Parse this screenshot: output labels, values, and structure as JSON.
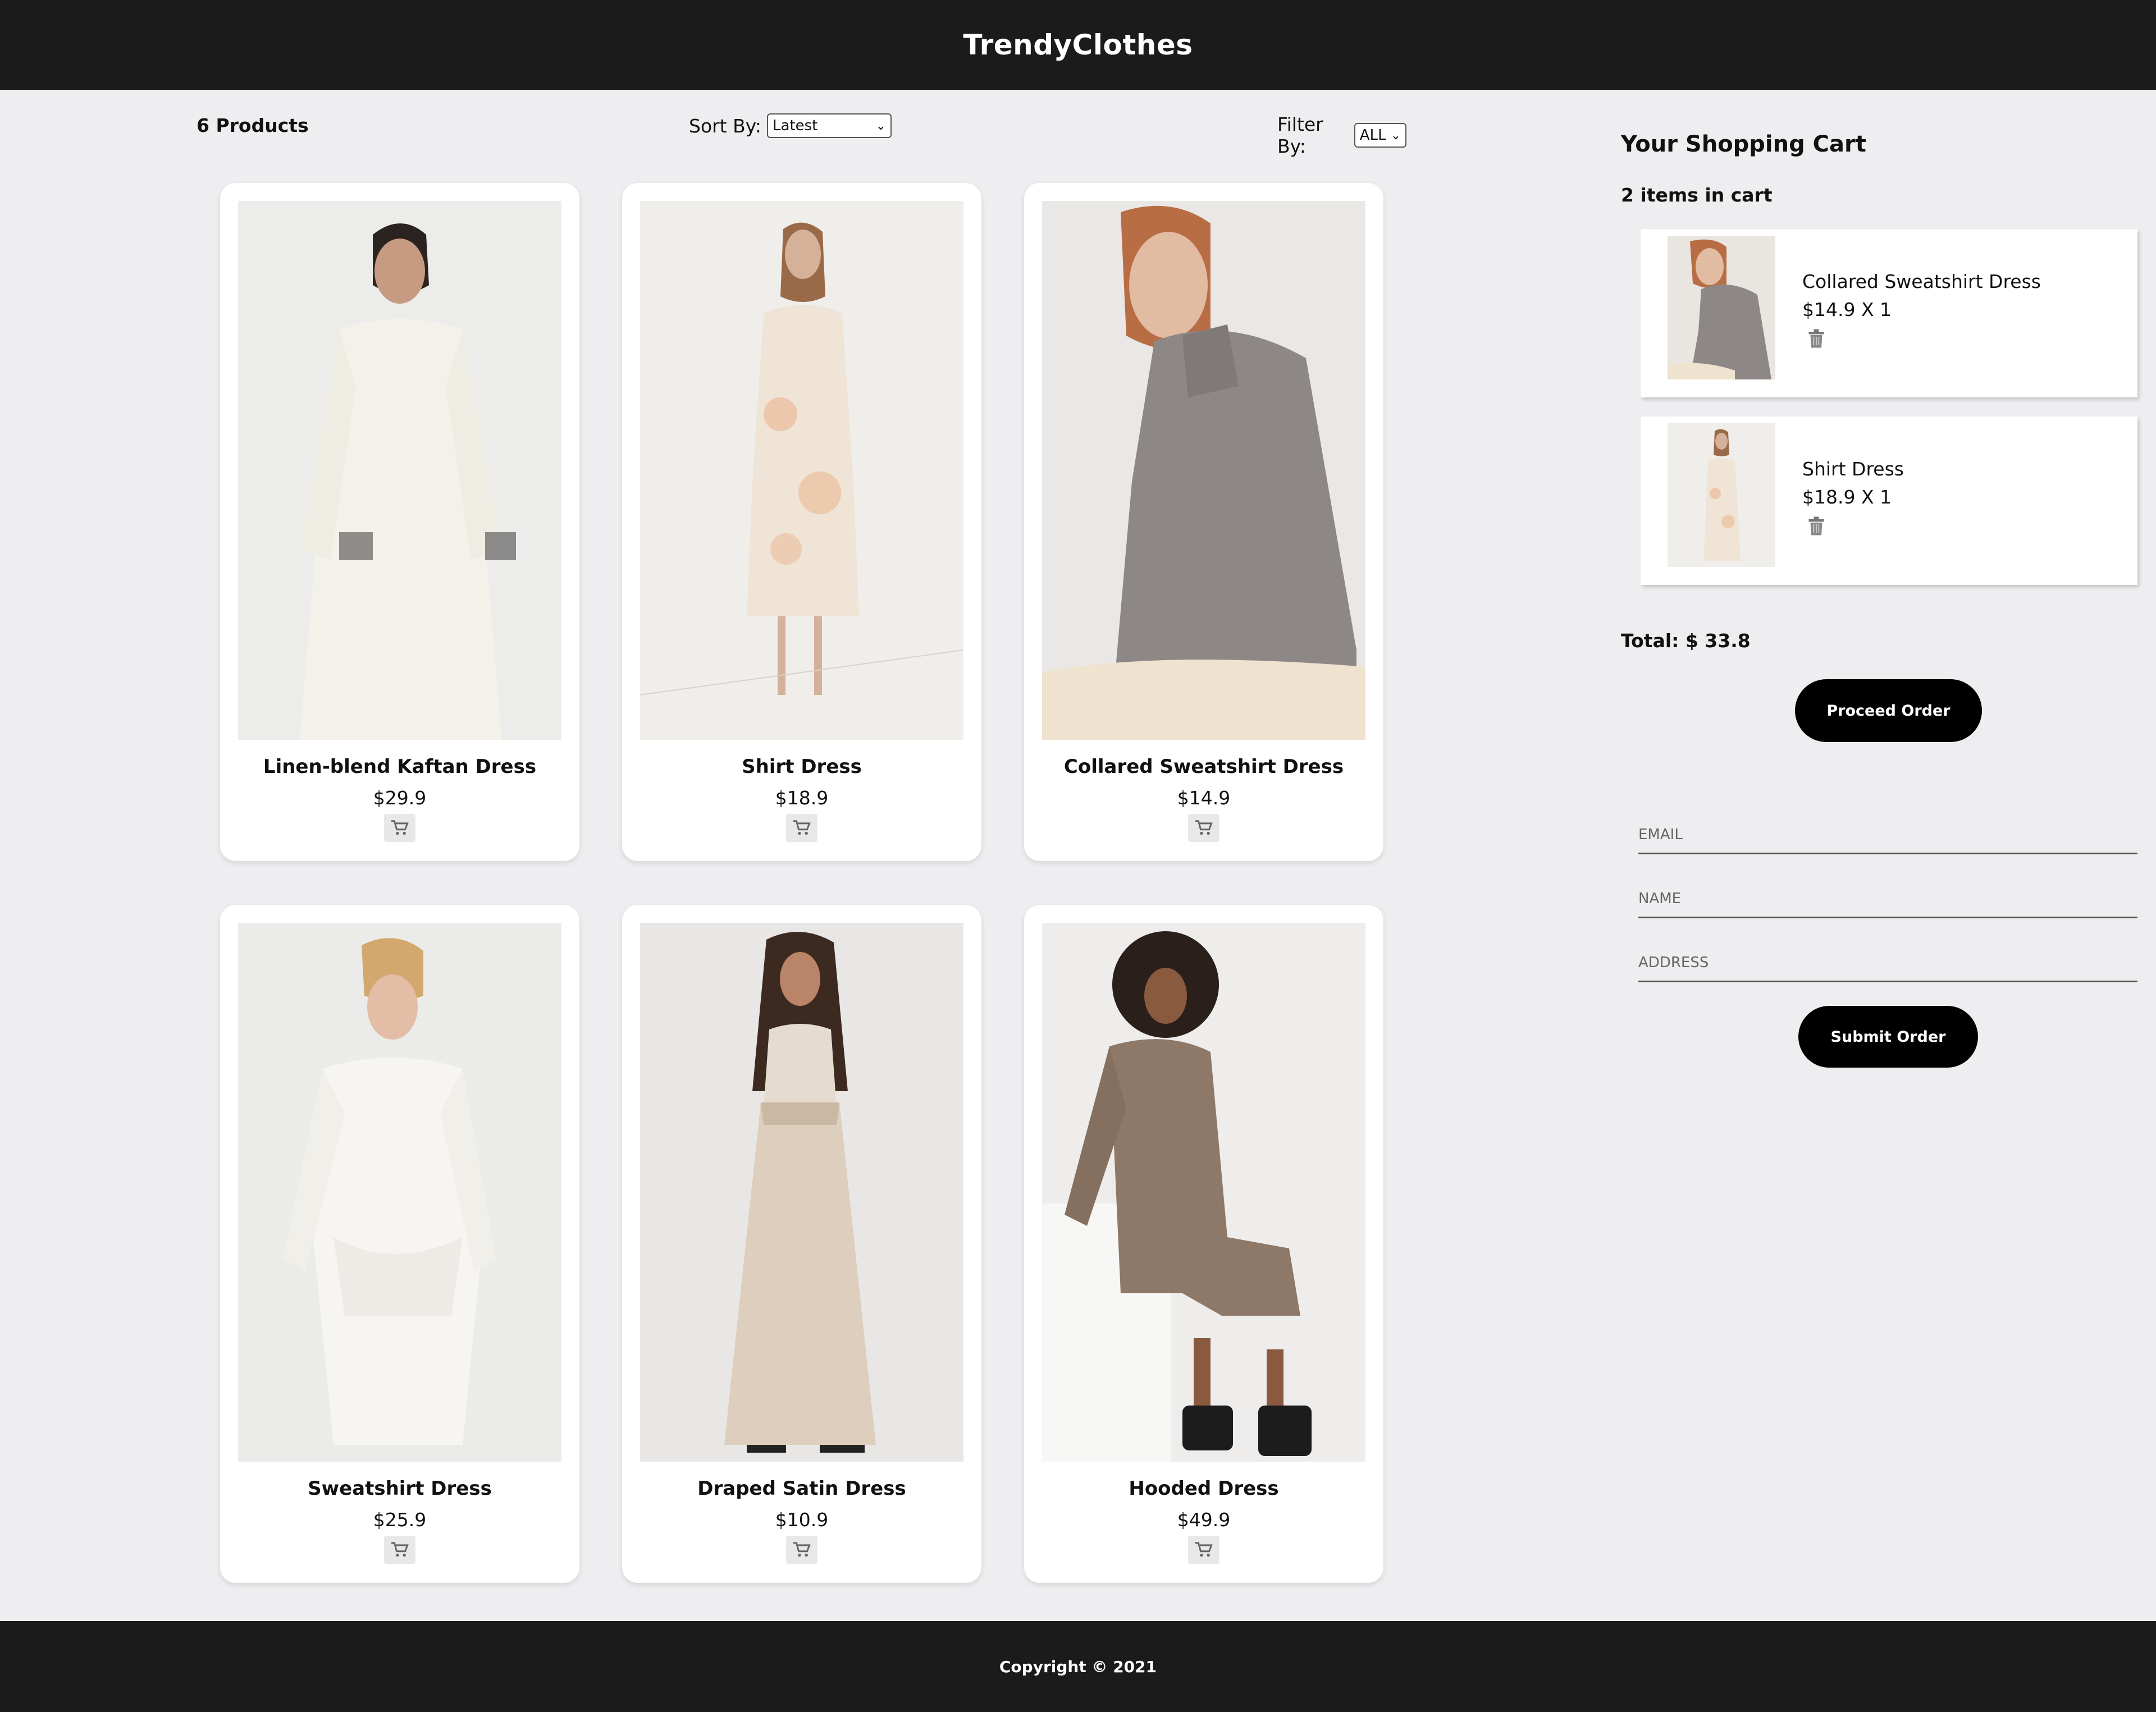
{
  "header": {
    "brand": "TrendyClothes"
  },
  "toolbar": {
    "count_label": "6 Products",
    "sort_label": "Sort By:",
    "sort_value": "Latest",
    "filter_label": "Filter By:",
    "filter_value": "ALL"
  },
  "products": [
    {
      "title": "Linen-blend Kaftan Dress",
      "price": "$29.9"
    },
    {
      "title": "Shirt Dress",
      "price": "$18.9"
    },
    {
      "title": "Collared Sweatshirt Dress",
      "price": "$14.9"
    },
    {
      "title": "Sweatshirt Dress",
      "price": "$25.9"
    },
    {
      "title": "Draped Satin Dress",
      "price": "$10.9"
    },
    {
      "title": "Hooded Dress",
      "price": "$49.9"
    }
  ],
  "cart": {
    "heading": "Your Shopping Cart",
    "count_label": "2 items in cart",
    "items": [
      {
        "name": "Collared Sweatshirt Dress",
        "qty": "$14.9 X 1"
      },
      {
        "name": "Shirt Dress",
        "qty": "$18.9 X 1"
      }
    ],
    "total": "Total: $ 33.8",
    "proceed_label": "Proceed Order",
    "email_placeholder": "EMAIL",
    "name_placeholder": "NAME",
    "address_placeholder": "ADDRESS",
    "submit_label": "Submit Order"
  },
  "footer": {
    "copyright": "Copyright © 2021"
  },
  "icons": {
    "cart": "cart-icon",
    "trash": "trash-icon",
    "dropdown": "chevron-down-icon"
  },
  "colors": {
    "header_bg": "#1b1b1b",
    "page_bg": "#eeeef0",
    "button_bg": "#000000",
    "card_bg": "#ffffff"
  }
}
